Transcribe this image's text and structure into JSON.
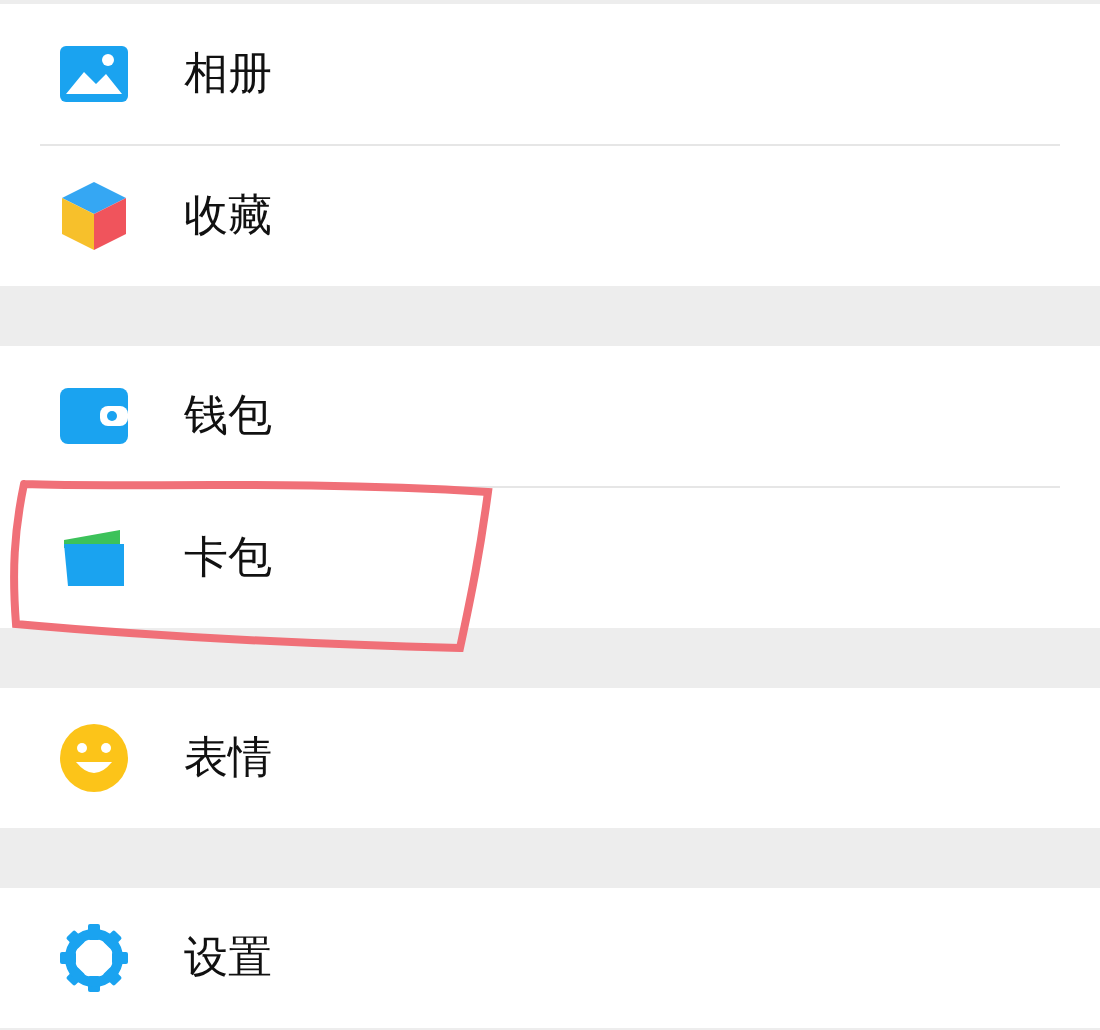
{
  "groups": [
    {
      "items": [
        {
          "kind": "photo",
          "label": "相册",
          "circled": false
        },
        {
          "kind": "cube",
          "label": "收藏",
          "circled": false
        }
      ]
    },
    {
      "items": [
        {
          "kind": "wallet",
          "label": "钱包",
          "circled": false
        },
        {
          "kind": "card",
          "label": "卡包",
          "circled": true
        }
      ]
    },
    {
      "items": [
        {
          "kind": "smiley",
          "label": "表情",
          "circled": false
        }
      ]
    },
    {
      "items": [
        {
          "kind": "gear",
          "label": "设置",
          "circled": false
        }
      ]
    }
  ]
}
